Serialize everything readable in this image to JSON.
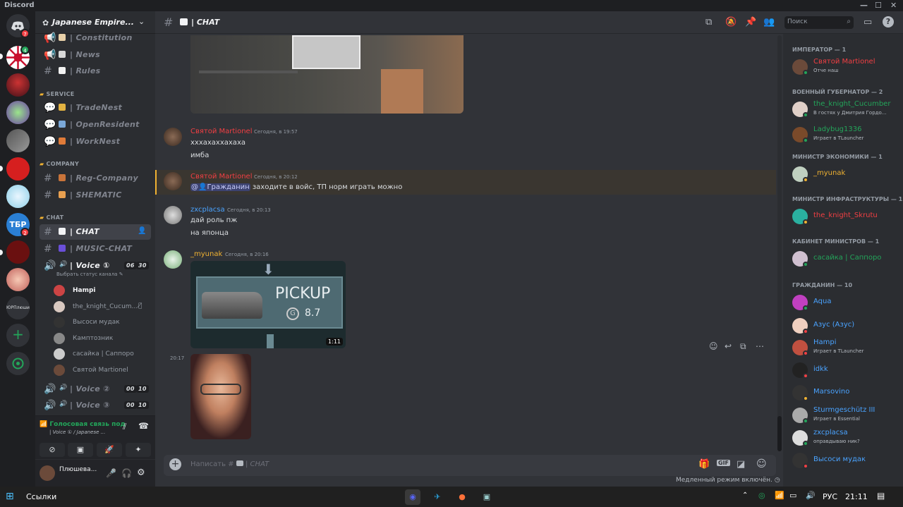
{
  "window": {
    "title": "Discord"
  },
  "server": {
    "name": "Japanese Empire..."
  },
  "guilds": [
    {
      "badge": "7"
    },
    {
      "badge": "4"
    },
    {
      "badge": ""
    },
    {
      "badge": ""
    },
    {
      "badge": ""
    },
    {
      "badge": ""
    },
    {
      "badge": ""
    },
    {
      "badge": "2"
    },
    {
      "badge": ""
    },
    {
      "badge": ""
    },
    {
      "label": "ЮРПлюши"
    }
  ],
  "channels": {
    "top": [
      {
        "label": "| Constitution"
      },
      {
        "label": "| News"
      },
      {
        "label": "| Rules"
      }
    ],
    "service_cat": "SERVICE",
    "service": [
      {
        "label": "| TradeNest"
      },
      {
        "label": "| OpenResident"
      },
      {
        "label": "| WorkNest"
      }
    ],
    "company_cat": "COMPANY",
    "company": [
      {
        "label": "| Reg-Company"
      },
      {
        "label": "| SHEMATIC"
      }
    ],
    "chat_cat": "CHAT",
    "chat": [
      {
        "label": "| CHAT"
      },
      {
        "label": "| MUSIC-CHAT"
      }
    ],
    "voice1": {
      "label": "| Voice ①",
      "status": "Выбрать статус канала",
      "c1": "06",
      "c2": "30"
    },
    "voice_users": [
      {
        "name": "Hampi"
      },
      {
        "name": "the_knight_Cucum..."
      },
      {
        "name": "Высоси мудак"
      },
      {
        "name": "Камптозник"
      },
      {
        "name": "сасайка | Саппоро"
      },
      {
        "name": "Святой Martionel"
      }
    ],
    "voice2": {
      "label": "| Voice ②",
      "c1": "00",
      "c2": "10"
    },
    "voice3": {
      "label": "| Voice ③",
      "c1": "00",
      "c2": "10"
    }
  },
  "voice_panel": {
    "status": "Голосовая связь под",
    "channel": "| Voice ① / Japanese ..."
  },
  "user_panel": {
    "name": "Плюшева..."
  },
  "header": {
    "channel": "| CHAT",
    "search_placeholder": "Поиск"
  },
  "messages": [
    {
      "author": "Святой Martionel",
      "time": "Сегодня, в 19:57",
      "lines": [
        "хххахаххахаха",
        "имба"
      ]
    },
    {
      "author": "Святой Martionel",
      "time": "Сегодня, в 20:12",
      "mention": "@",
      "mention_name": "Гражданин",
      "text": "заходите в войс, ТП норм играть можно"
    },
    {
      "author": "zxcplacsa",
      "time": "Сегодня, в 20:13",
      "lines": [
        "дай роль пж",
        "на японца"
      ]
    },
    {
      "author": "_myunak",
      "time": "Сегодня, в 20:16",
      "video_title": "PICKUP",
      "video_price": "8.7",
      "video_duration": "1:11"
    },
    {
      "time": "20:17"
    }
  ],
  "composer": {
    "placeholder": "Написать #",
    "channel": "| CHAT",
    "slowmode": "Медленный режим включён."
  },
  "members": {
    "groups": [
      {
        "title": "ИМПЕРАТОР — 1",
        "members": [
          {
            "name": "Святой Martionel",
            "sub": "Отче наш"
          }
        ]
      },
      {
        "title": "ВОЕННЫЙ ГУБЕРНАТОР — 2",
        "members": [
          {
            "name": "the_knight_Cucumber",
            "sub": "В гостях у Дмитрия Гордо..."
          },
          {
            "name": "Ladybug1336",
            "sub": "Играет в TLauncher"
          }
        ]
      },
      {
        "title": "МИНИСТР ЭКОНОМИКИ — 1",
        "members": [
          {
            "name": "_myunak",
            "sub": ""
          }
        ]
      },
      {
        "title": "МИНИСТР ИНФРАСТРУКТУРЫ — 1",
        "members": [
          {
            "name": "the_knight_Skrutu",
            "sub": ""
          }
        ]
      },
      {
        "title": "КАБИНЕТ МИНИСТРОВ — 1",
        "members": [
          {
            "name": "сасайка | Саппоро",
            "sub": ""
          }
        ]
      },
      {
        "title": "ГРАЖДАНИН — 10",
        "members": [
          {
            "name": "Aqua",
            "sub": ""
          },
          {
            "name": "Азус (Азус)",
            "sub": ""
          },
          {
            "name": "Hampi",
            "sub": "Играет в TLauncher"
          },
          {
            "name": "idkk",
            "sub": ""
          },
          {
            "name": "Marsovino",
            "sub": ""
          },
          {
            "name": "Sturmgeschütz III",
            "sub": "Играет в Essential"
          },
          {
            "name": "zxcplacsa",
            "sub": "оправдываю ник?"
          },
          {
            "name": "Высоси мудак",
            "sub": ""
          }
        ]
      }
    ]
  },
  "taskbar": {
    "links": "Ссылки",
    "lang": "РУС",
    "time": "21:11"
  },
  "colors": {
    "red_role": "#f23f43",
    "green_role": "#23a55a",
    "gold_role": "#f0b232",
    "blue_role": "#4aa3ff",
    "teal_role": "#3ec6c0",
    "blurple": "#5865f2"
  }
}
